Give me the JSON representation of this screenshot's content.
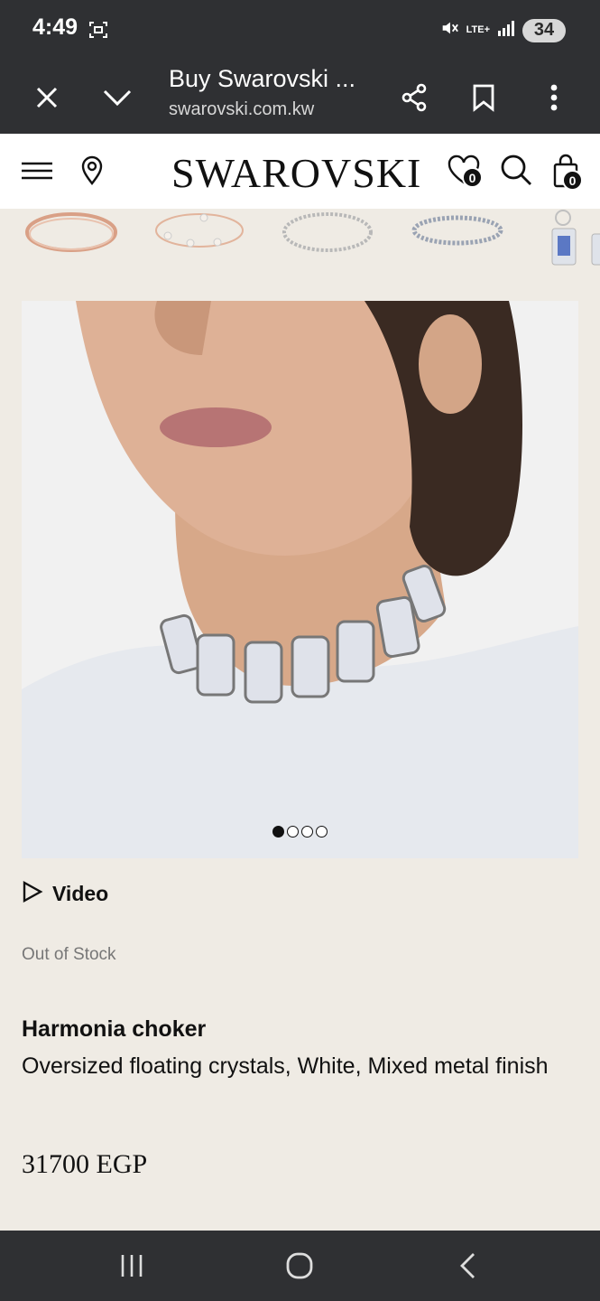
{
  "status": {
    "time": "4:49",
    "battery": "34",
    "network": "LTE+"
  },
  "browser": {
    "title": "Buy Swarovski ...",
    "url": "swarovski.com.kw"
  },
  "site": {
    "logo": "SWAROVSKI",
    "wishlist_count": "0",
    "cart_count": "0"
  },
  "gallery": {
    "thumbnails": [
      "rose-gold-bangle",
      "pearl-bracelet",
      "tennis-bracelet-silver",
      "tennis-bracelet-blue",
      "blue-crystal-drop-earring"
    ],
    "hero_description": "Model wearing oversized crystal choker",
    "slides": 4,
    "active_slide": 1
  },
  "product": {
    "video_label": "Video",
    "stock_status": "Out of Stock",
    "name": "Harmonia choker",
    "description": "Oversized floating crystals, White, Mixed metal finish",
    "price": "31700 EGP"
  },
  "colors": {
    "system_bar": "#2f3033",
    "page_bg": "#efebe4",
    "text": "#111111"
  }
}
